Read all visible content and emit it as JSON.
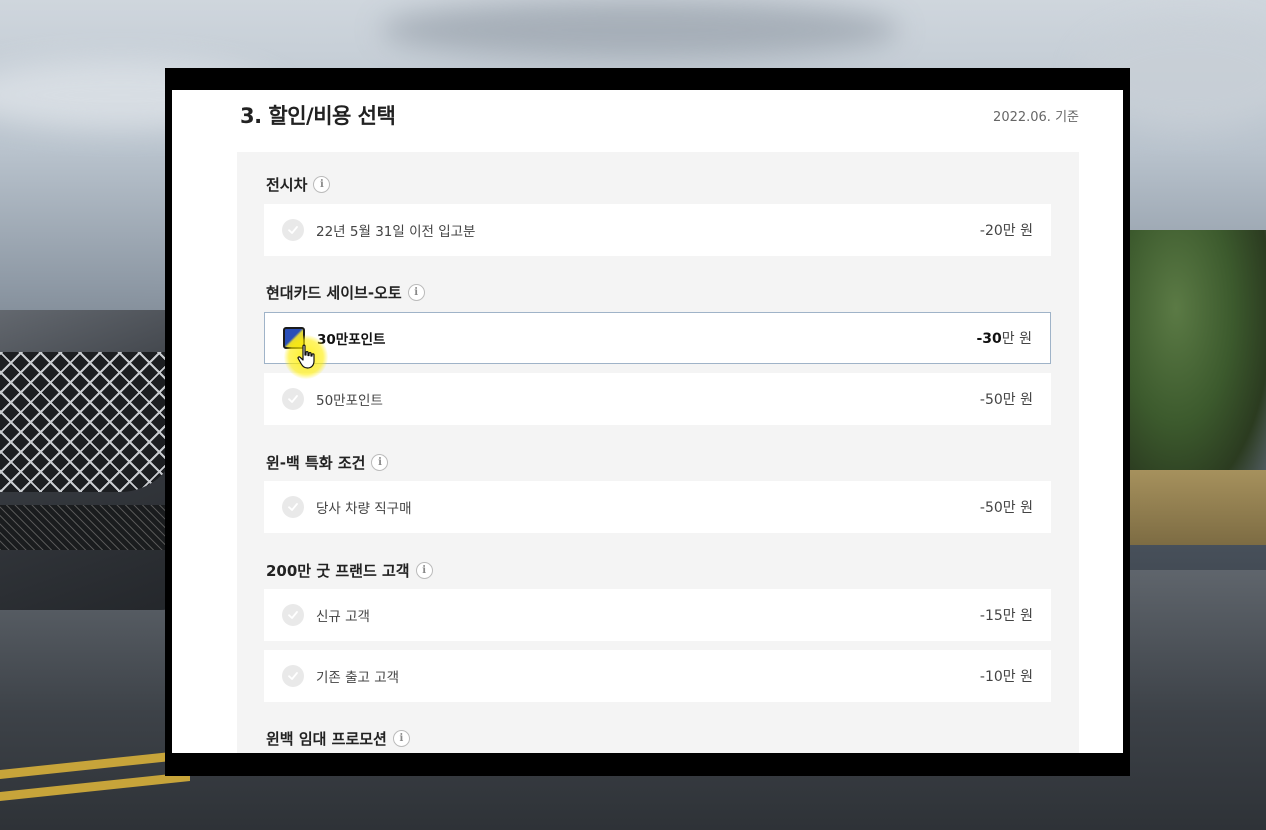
{
  "section": {
    "title": "3. 할인/비용 선택",
    "date_note": "2022.06. 기준"
  },
  "groups": [
    {
      "title": "전시차",
      "options": [
        {
          "label": "22년 5월 31일 이전 입고분",
          "price": "-20만 원"
        }
      ]
    },
    {
      "title": "현대카드 세이브-오토",
      "options": [
        {
          "label": "30만포인트",
          "price_amount": "-30",
          "price_unit": "만 원",
          "selected": true
        },
        {
          "label": "50만포인트",
          "price": "-50만 원"
        }
      ]
    },
    {
      "title": "윈-백 특화 조건",
      "options": [
        {
          "label": "당사 차량 직구매",
          "price": "-50만 원"
        }
      ]
    },
    {
      "title": "200만 굿 프랜드 고객",
      "options": [
        {
          "label": "신규 고객",
          "price": "-15만 원"
        },
        {
          "label": "기존 출고 고객",
          "price": "-10만 원"
        }
      ]
    },
    {
      "title": "윈백 임대 프로모션",
      "options": []
    }
  ],
  "info_icon_glyph": "i",
  "colors": {
    "selected_border": "#9fb3c8",
    "checkbox_blue": "#2a4fb8",
    "checkbox_yellow": "#e4d83a",
    "cursor_highlight": "#ffee00"
  }
}
